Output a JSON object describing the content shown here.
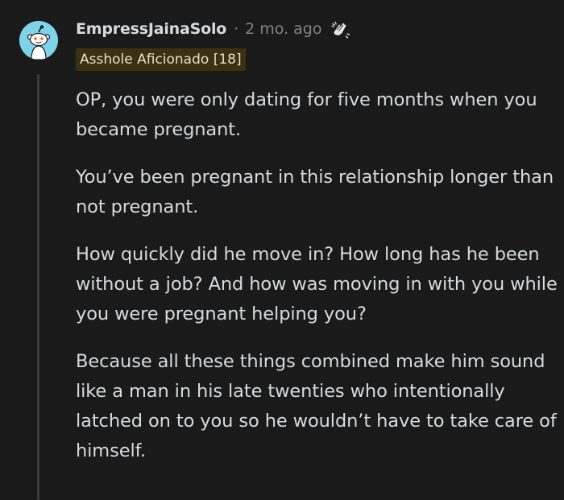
{
  "comment": {
    "username": "EmpressJainaSolo",
    "separator": "·",
    "timestamp": "2 mo. ago",
    "award_icon": "clapping-hands-icon",
    "avatar_icon": "snoo-avatar-icon",
    "flair": "Asshole Aficionado [18]",
    "paragraphs": [
      "OP, you were only dating for five months when you became pregnant.",
      "You’ve been pregnant in this relationship longer than not pregnant.",
      "How quickly did he move in? How long has he been without a job? And how was moving in with you while you were pregnant helping you?",
      "Because all these things combined make him sound like a man in his late twenties who intentionally latched on to you so he wouldn’t have to take care of himself."
    ]
  },
  "colors": {
    "background": "#1a1a1b",
    "text": "#d7dadc",
    "meta": "#818384",
    "avatar_bg": "#7fd3e8",
    "flair_bg": "#3b3012",
    "thread_line": "#3a3a3c"
  }
}
